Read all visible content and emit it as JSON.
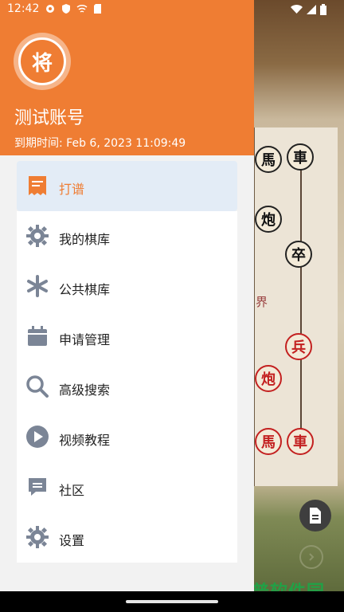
{
  "status_bar": {
    "time": "12:42"
  },
  "drawer": {
    "logo_text": "将",
    "account_name": "测试账号",
    "expiry_label": "到期时间:",
    "expiry_value": "Feb 6, 2023 11:09:49",
    "accent_color": "#ef7d33",
    "menu": [
      {
        "label": "打谱",
        "icon": "scroll-icon",
        "active": true
      },
      {
        "label": "我的棋库",
        "icon": "gear-icon",
        "active": false
      },
      {
        "label": "公共棋库",
        "icon": "asterisk-icon",
        "active": false
      },
      {
        "label": "申请管理",
        "icon": "calendar-icon",
        "active": false
      },
      {
        "label": "高级搜索",
        "icon": "search-icon",
        "active": false
      },
      {
        "label": "视频教程",
        "icon": "play-icon",
        "active": false
      },
      {
        "label": "社区",
        "icon": "message-icon",
        "active": false
      },
      {
        "label": "设置",
        "icon": "settings-icon",
        "active": false
      }
    ]
  },
  "board": {
    "pieces": [
      "馬",
      "車",
      "炮",
      "卒",
      "兵",
      "炮",
      "馬",
      "車"
    ],
    "river_text": "界"
  },
  "watermark": "谷普软件园"
}
